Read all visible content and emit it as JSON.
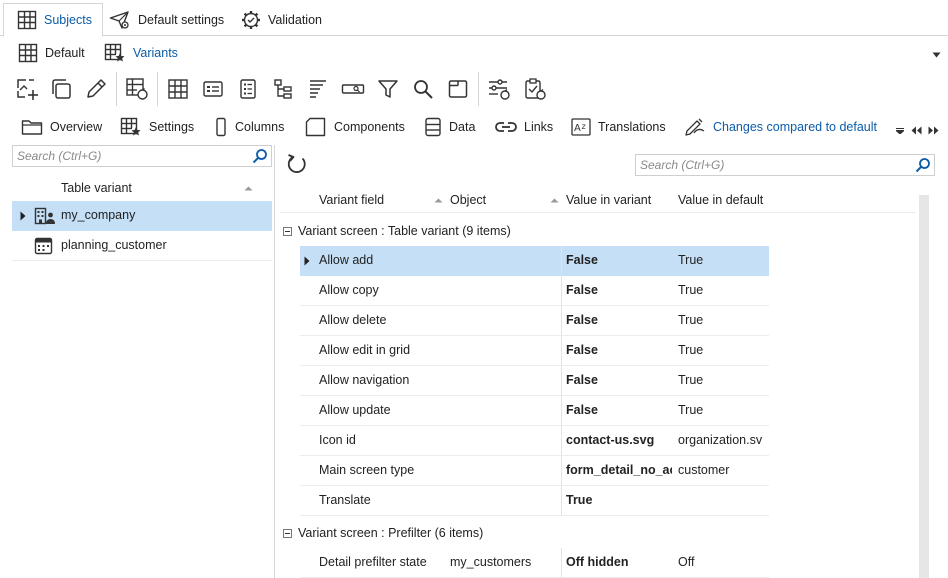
{
  "top_tabs": [
    {
      "label": "Subjects",
      "icon": "table-icon",
      "active": true
    },
    {
      "label": "Default settings",
      "icon": "paper-plane-gear-icon",
      "active": false
    },
    {
      "label": "Validation",
      "icon": "gear-check-icon",
      "active": false
    }
  ],
  "sub_tabs": [
    {
      "label": "Default",
      "icon": "table-icon",
      "active": false
    },
    {
      "label": "Variants",
      "icon": "table-star-icon",
      "active": true
    }
  ],
  "toolbar": [
    "add-icon",
    "copy-icon",
    "edit-icon",
    "table-refresh-icon",
    "table-icon",
    "form-icon",
    "list-icon",
    "tree-icon",
    "lines-icon",
    "textbox-icon",
    "filter-icon",
    "search-icon",
    "window-icon",
    "settings-sliders-icon",
    "clipboard-check-icon"
  ],
  "view_tabs": [
    {
      "label": "Overview",
      "icon": "folder-icon"
    },
    {
      "label": "Settings",
      "icon": "table-star-icon"
    },
    {
      "label": "Columns",
      "icon": "column-icon"
    },
    {
      "label": "Components",
      "icon": "component-icon"
    },
    {
      "label": "Data",
      "icon": "data-icon"
    },
    {
      "label": "Links",
      "icon": "link-icon"
    },
    {
      "label": "Translations",
      "icon": "translate-icon"
    },
    {
      "label": "Changes compared to default",
      "icon": "changes-icon",
      "active": true
    }
  ],
  "left_search": {
    "placeholder": "Search (Ctrl+G)",
    "value": ""
  },
  "right_search": {
    "placeholder": "Search (Ctrl+G)",
    "value": ""
  },
  "left_pane": {
    "header": "Table variant",
    "rows": [
      {
        "label": "my_company",
        "icon": "organization-icon",
        "selected": true
      },
      {
        "label": "planning_customer",
        "icon": "calendar-icon",
        "selected": false
      }
    ]
  },
  "grid": {
    "columns": [
      "Variant field",
      "Object",
      "Value in variant",
      "Value in default"
    ],
    "groups": [
      {
        "title": "Variant screen : Table variant (9 items)",
        "rows": [
          {
            "field": "Allow add",
            "object": "",
            "value": "False",
            "default": "True",
            "selected": true
          },
          {
            "field": "Allow copy",
            "object": "",
            "value": "False",
            "default": "True"
          },
          {
            "field": "Allow delete",
            "object": "",
            "value": "False",
            "default": "True"
          },
          {
            "field": "Allow edit in grid",
            "object": "",
            "value": "False",
            "default": "True"
          },
          {
            "field": "Allow navigation",
            "object": "",
            "value": "False",
            "default": "True"
          },
          {
            "field": "Allow update",
            "object": "",
            "value": "False",
            "default": "True"
          },
          {
            "field": "Icon id",
            "object": "",
            "value": "contact-us.svg",
            "default": "organization.sv"
          },
          {
            "field": "Main screen type",
            "object": "",
            "value": "form_detail_no_ac",
            "default": "customer"
          },
          {
            "field": "Translate",
            "object": "",
            "value": "True",
            "default": ""
          }
        ]
      },
      {
        "title": "Variant screen : Prefilter (6 items)",
        "rows": [
          {
            "field": "Detail prefilter state",
            "object": "my_customers",
            "value": "Off hidden",
            "default": "Off"
          }
        ]
      }
    ]
  },
  "colors": {
    "accent": "#0b5ca8",
    "selection": "#c4dff6",
    "border": "#d6d6d6"
  }
}
